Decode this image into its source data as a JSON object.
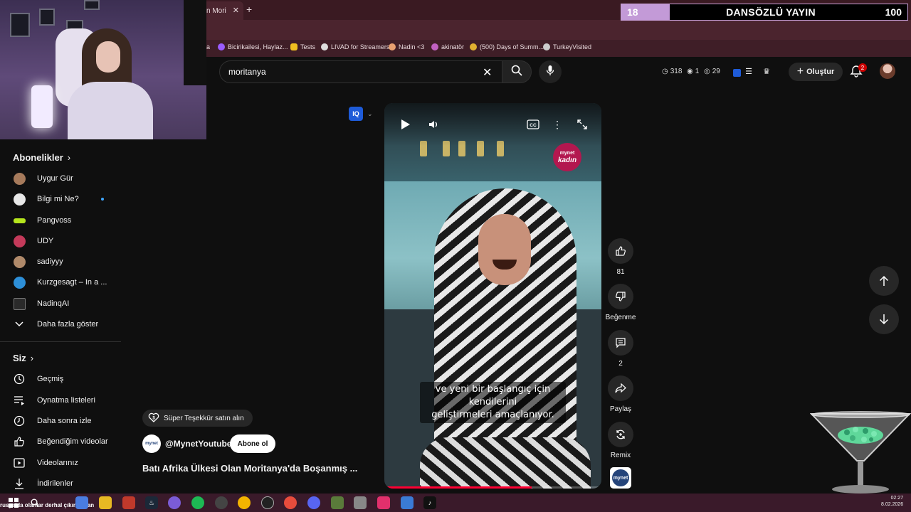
{
  "browser": {
    "tab_title": "n Mori",
    "new_tab_symbol": "+",
    "tab_close_symbol": "✕",
    "bookmarks": [
      {
        "label": "a",
        "color": "#e8d8dc"
      },
      {
        "label": "Bicirikailesi, Haylaz...",
        "color": "#9a5cff"
      },
      {
        "label": "Tests",
        "color": "#f0c020"
      },
      {
        "label": "LIVAD for Streamers",
        "color": "#dddddd"
      },
      {
        "label": "Nadin <3",
        "color": "#e7a070"
      },
      {
        "label": "akinatör",
        "color": "#c060c0"
      },
      {
        "label": "(500) Days of Summ...",
        "color": "#e0b030"
      },
      {
        "label": "TurkeyVisited",
        "color": "#cccccc"
      }
    ]
  },
  "counter": {
    "left_value": "18",
    "title": "DANSÖZLÜ YAYIN",
    "right_value": "100"
  },
  "header": {
    "search_value": "moritanya",
    "stats": [
      {
        "icon": "clock-icon",
        "value": "318"
      },
      {
        "icon": "eye-icon",
        "value": "1"
      },
      {
        "icon": "eye-icon",
        "value": "29"
      }
    ],
    "create_label": "Oluştur",
    "notification_count": "2"
  },
  "sidebar": {
    "subscriptions_heading": "Abonelikler",
    "subscriptions": [
      {
        "label": "Uygur Gür",
        "avatar_color": "#a67a5b",
        "dot": false
      },
      {
        "label": "Bilgi mi Ne?",
        "avatar_color": "#e8e8e8",
        "dot": true
      },
      {
        "label": "Pangvoss",
        "avatar_color": "#b5e51d",
        "dot": false
      },
      {
        "label": "UDY",
        "avatar_color": "#c43a5a",
        "dot": false
      },
      {
        "label": "sadiyyy",
        "avatar_color": "#b08a6a",
        "dot": false
      },
      {
        "label": "Kurzgesagt – In a ...",
        "avatar_color": "#2d8fd8",
        "dot": false
      },
      {
        "label": "NadinqAI",
        "avatar_color": "#2a2a2a",
        "dot": false
      }
    ],
    "show_more_label": "Daha fazla göster",
    "you_heading": "Siz",
    "you_items": [
      {
        "label": "Geçmiş",
        "icon": "history-icon"
      },
      {
        "label": "Oynatma listeleri",
        "icon": "playlists-icon"
      },
      {
        "label": "Daha sonra izle",
        "icon": "watch-later-icon"
      },
      {
        "label": "Beğendiğim videolar",
        "icon": "liked-icon"
      },
      {
        "label": "Videolarınız",
        "icon": "your-videos-icon"
      },
      {
        "label": "İndirilenler",
        "icon": "download-icon"
      }
    ]
  },
  "video": {
    "chip_label": "IQ",
    "brand_small": "mynet",
    "brand_big": "kadın",
    "subtitle_line1": "ve yeni bir başlangıç için kendilerini",
    "subtitle_line2": "geliştirmeleri amaçlanıyor.",
    "progress": 0.68,
    "super_thanks_label": "Süper Teşekkür satın alın",
    "channel_name": "@MynetYoutube",
    "channel_avatar_text": "mynet",
    "subscribe_label": "Abone ol",
    "title": "Batı Afrika Ülkesi Olan Moritanya'da Boşanmış ..."
  },
  "actions": {
    "like_count": "81",
    "dislike_label": "Beğenme",
    "comment_count": "2",
    "share_label": "Paylaş",
    "remix_label": "Remix",
    "channel_thumb_text": "mynet"
  },
  "taskbar": {
    "ticker": "rusya'da olanlar derhal çıkın ordan",
    "time": "02:27",
    "date": "8.02.2026"
  }
}
